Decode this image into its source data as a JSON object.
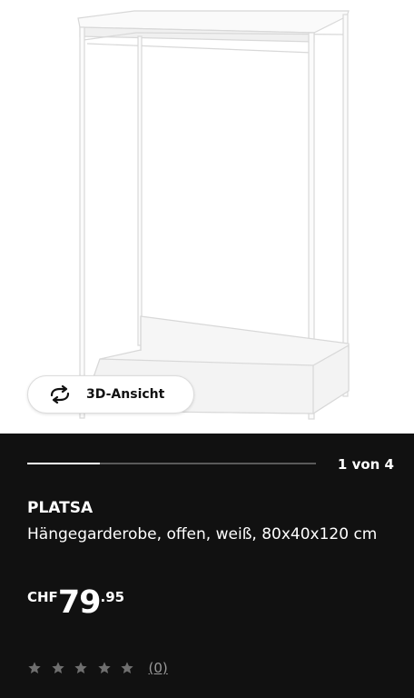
{
  "gallery": {
    "view_3d_label": "3D-Ansicht",
    "view_3d_icon": "rotate-3d-icon",
    "current": 1,
    "total": 4,
    "counter_text": "1 von 4",
    "progress_fraction": 0.25
  },
  "product": {
    "name": "PLATSA",
    "description": "Hängegarderobe, offen, weiß, 80x40x120 cm",
    "price": {
      "currency": "CHF",
      "integer": "79",
      "decimal": ".95"
    },
    "rating": {
      "stars": 5,
      "filled": 0,
      "star_icon": "star-icon",
      "count_text": "(0)"
    }
  },
  "colors": {
    "panel_background": "#111111",
    "image_background": "#ffffff",
    "text": "#ffffff",
    "muted": "#9a9a9a"
  }
}
